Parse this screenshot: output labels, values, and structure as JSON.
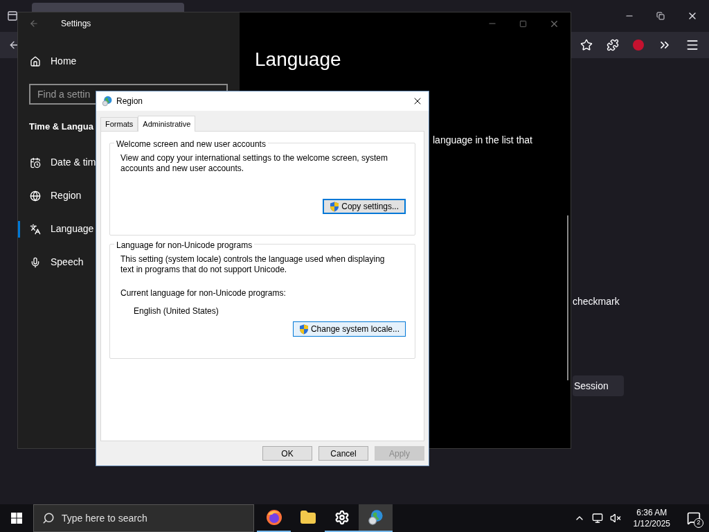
{
  "browser": {
    "content_text": "checkmark",
    "session_button": "Session"
  },
  "settings_window": {
    "title": "Settings",
    "home": "Home",
    "search_placeholder": "Find a settin",
    "section": "Time & Langua",
    "nav_items": [
      {
        "label": "Date & tim",
        "kind": "calendar",
        "selected": false
      },
      {
        "label": "Region",
        "kind": "globe",
        "selected": false
      },
      {
        "label": "Language",
        "kind": "language",
        "selected": true
      },
      {
        "label": "Speech",
        "kind": "microphone",
        "selected": false
      }
    ],
    "heading": "Language",
    "body_fragment": "language in the list that"
  },
  "region_dialog": {
    "title": "Region",
    "tabs": [
      {
        "label": "Formats",
        "selected": false
      },
      {
        "label": "Administrative",
        "selected": true
      }
    ],
    "groups": [
      {
        "title": "Welcome screen and new user accounts",
        "description": "View and copy your international settings to the welcome screen, system accounts and new user accounts.",
        "button": {
          "label": "Copy settings...",
          "focused": true,
          "hovered": false
        }
      },
      {
        "title": "Language for non-Unicode programs",
        "description": "This setting (system locale) controls the language used when displaying text in programs that do not support Unicode.",
        "current_label": "Current language for non-Unicode programs:",
        "current_value": "English (United States)",
        "button": {
          "label": "Change system locale...",
          "focused": false,
          "hovered": true
        }
      }
    ],
    "buttons": [
      {
        "label": "OK",
        "disabled": false
      },
      {
        "label": "Cancel",
        "disabled": false
      },
      {
        "label": "Apply",
        "disabled": true
      }
    ]
  },
  "taskbar": {
    "search_placeholder": "Type here to search",
    "apps": [
      {
        "kind": "firefox",
        "running": true,
        "selected": false
      },
      {
        "kind": "folder",
        "running": false,
        "selected": false
      },
      {
        "kind": "gear",
        "running": true,
        "selected": false
      },
      {
        "kind": "globe",
        "running": true,
        "selected": true
      }
    ],
    "time": "6:36 AM",
    "date": "1/12/2025",
    "notification_count": "2"
  }
}
